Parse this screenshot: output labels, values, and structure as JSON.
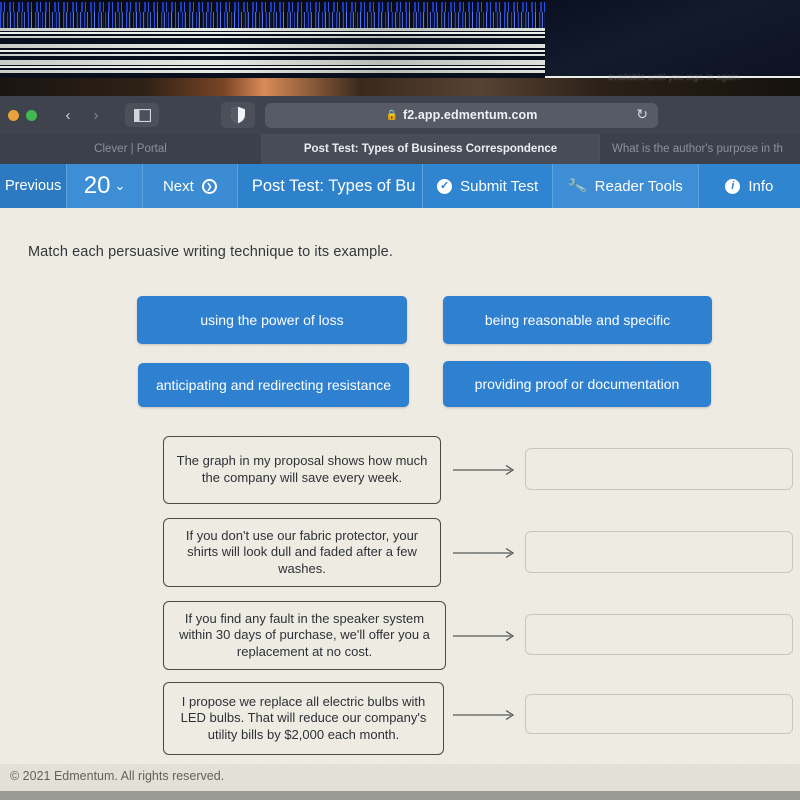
{
  "glitch": {
    "ghost_text": "available until you sign in again."
  },
  "browser": {
    "traffic_lights": [
      "close-dot",
      "minimize-dot",
      "maximize-dot"
    ],
    "back_icon": "‹",
    "forward_icon": "›",
    "sidebar_icon": "sidebar-toggle-icon",
    "shield_icon": "shield-icon",
    "lock_icon": "🔒",
    "url": "f2.app.edmentum.com",
    "reload_icon": "↻",
    "tabs": [
      {
        "title": "Clever | Portal",
        "active": false
      },
      {
        "title": "Post Test: Types of Business Correspondence",
        "active": true
      },
      {
        "title": "What is the author's purpose in th",
        "active": false
      }
    ]
  },
  "toolbar": {
    "previous_label": "Previous",
    "question_number": "20",
    "question_caret": "⌄",
    "next_label": "Next",
    "next_icon": "❯",
    "test_title": "Post Test: Types of Bu",
    "submit_label": "Submit Test",
    "submit_icon": "✓",
    "reader_tools_label": "Reader Tools",
    "reader_tools_icon": "🔧",
    "info_label": "Info",
    "info_icon": "i",
    "accent_blue": "#2e82cc"
  },
  "question": {
    "prompt": "Match each persuasive writing technique to its example.",
    "options": [
      {
        "id": "opt-a",
        "label": "using the power of loss"
      },
      {
        "id": "opt-b",
        "label": "being reasonable and specific"
      },
      {
        "id": "opt-c",
        "label": "anticipating and redirecting resistance"
      },
      {
        "id": "opt-d",
        "label": "providing proof or documentation"
      }
    ],
    "statements": [
      {
        "id": "card-1",
        "text": "The graph in my proposal shows how much the company will save every week."
      },
      {
        "id": "card-2",
        "text": "If you don't use our fabric protector, your shirts will look dull and faded after a few washes."
      },
      {
        "id": "card-3",
        "text": "If you find any fault in the speaker system within 30 days of purchase, we'll offer you a replacement at no cost."
      },
      {
        "id": "card-4",
        "text": "I propose we replace all electric bulbs with LED bulbs. That will reduce our company's utility bills by $2,000 each month."
      }
    ],
    "drop_targets": [
      {
        "id": "drop-1",
        "value": ""
      },
      {
        "id": "drop-2",
        "value": ""
      },
      {
        "id": "drop-3",
        "value": ""
      },
      {
        "id": "drop-4",
        "value": ""
      }
    ],
    "option_blue": "#2f81d1"
  },
  "footer": {
    "copyright": "© 2021 Edmentum. All rights reserved."
  }
}
